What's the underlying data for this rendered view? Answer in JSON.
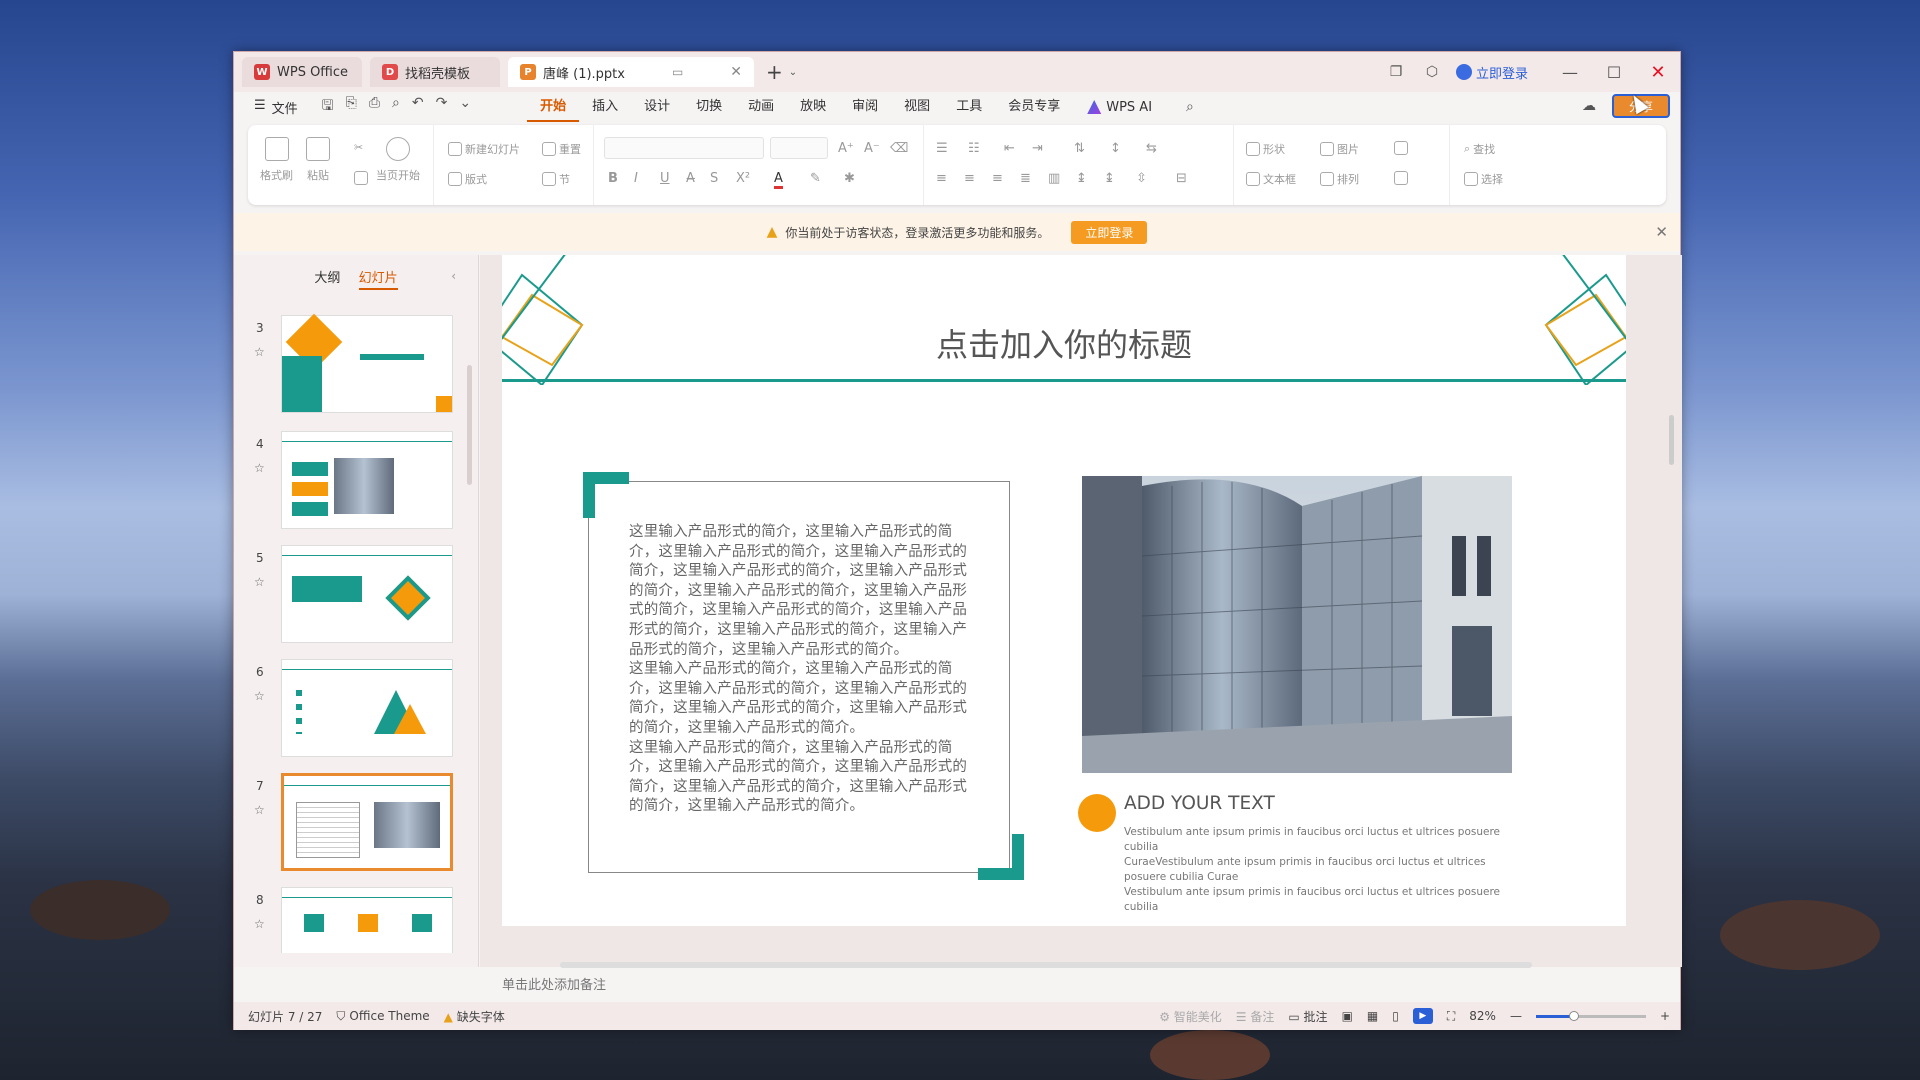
{
  "tabs": [
    {
      "label": "WPS Office",
      "icon": "wps-logo-icon",
      "color": "#d83b3b"
    },
    {
      "label": "找稻壳模板",
      "icon": "docer-logo-icon",
      "color": "#e04a4a"
    },
    {
      "label": "唐峰 (1).pptx",
      "icon": "ppt-file-icon",
      "color": "#e8832d"
    }
  ],
  "titlebar": {
    "login_label": "立即登录"
  },
  "menu": {
    "file_label": "文件",
    "tabs": [
      "开始",
      "插入",
      "设计",
      "切换",
      "动画",
      "放映",
      "审阅",
      "视图",
      "工具",
      "会员专享"
    ],
    "active_tab": "开始",
    "wps_ai_label": "WPS AI",
    "share_label": "分享"
  },
  "ribbon": {
    "format_painter": "格式刷",
    "paste": "粘贴",
    "from_current": "当页开始",
    "new_slide": "新建幻灯片",
    "reset": "重置",
    "layout": "版式",
    "section": "节",
    "shape": "形状",
    "picture": "图片",
    "textbox": "文本框",
    "arrange": "排列",
    "find": "查找",
    "select": "选择"
  },
  "notice": {
    "text": "你当前处于访客状态，登录激活更多功能和服务。",
    "button": "立即登录"
  },
  "panel": {
    "tab_outline": "大纲",
    "tab_slides": "幻灯片",
    "slides": [
      {
        "num": "3",
        "selected": false
      },
      {
        "num": "4",
        "selected": false
      },
      {
        "num": "5",
        "selected": false
      },
      {
        "num": "6",
        "selected": false
      },
      {
        "num": "7",
        "selected": true
      },
      {
        "num": "8",
        "selected": false
      }
    ]
  },
  "slide": {
    "title": "点击加入你的标题",
    "paragraphs": [
      "这里输入产品形式的简介，这里输入产品形式的简介，这里输入产品形式的简介，这里输入产品形式的简介，这里输入产品形式的简介，这里输入产品形式的简介，这里输入产品形式的简介，这里输入产品形式的简介，这里输入产品形式的简介，这里输入产品形式的简介，这里输入产品形式的简介，这里输入产品形式的简介，这里输入产品形式的简介。",
      "这里输入产品形式的简介，这里输入产品形式的简介，这里输入产品形式的简介，这里输入产品形式的简介，这里输入产品形式的简介，这里输入产品形式的简介，这里输入产品形式的简介。",
      "这里输入产品形式的简介，这里输入产品形式的简介，这里输入产品形式的简介，这里输入产品形式的简介，这里输入产品形式的简介，这里输入产品形式的简介，这里输入产品形式的简介。"
    ],
    "add_text": "ADD YOUR TEXT",
    "lorem_lines": [
      "Vestibulum ante ipsum primis in faucibus orci luctus et ultrices posuere cubilia",
      "CuraeVestibulum ante ipsum primis in faucibus orci luctus et ultrices posuere cubilia Curae",
      "Vestibulum ante ipsum primis in faucibus orci luctus et ultrices posuere cubilia"
    ],
    "accent_teal": "#1a9a8c",
    "accent_orange": "#f59b0b"
  },
  "notes_placeholder": "单击此处添加备注",
  "status": {
    "slide_info": "幻灯片 7 / 27",
    "theme": "Office Theme",
    "missing_font": "缺失字体",
    "beautify": "智能美化",
    "notes": "备注",
    "comments": "批注",
    "zoom": "82%",
    "zoom_value": 0.35
  }
}
